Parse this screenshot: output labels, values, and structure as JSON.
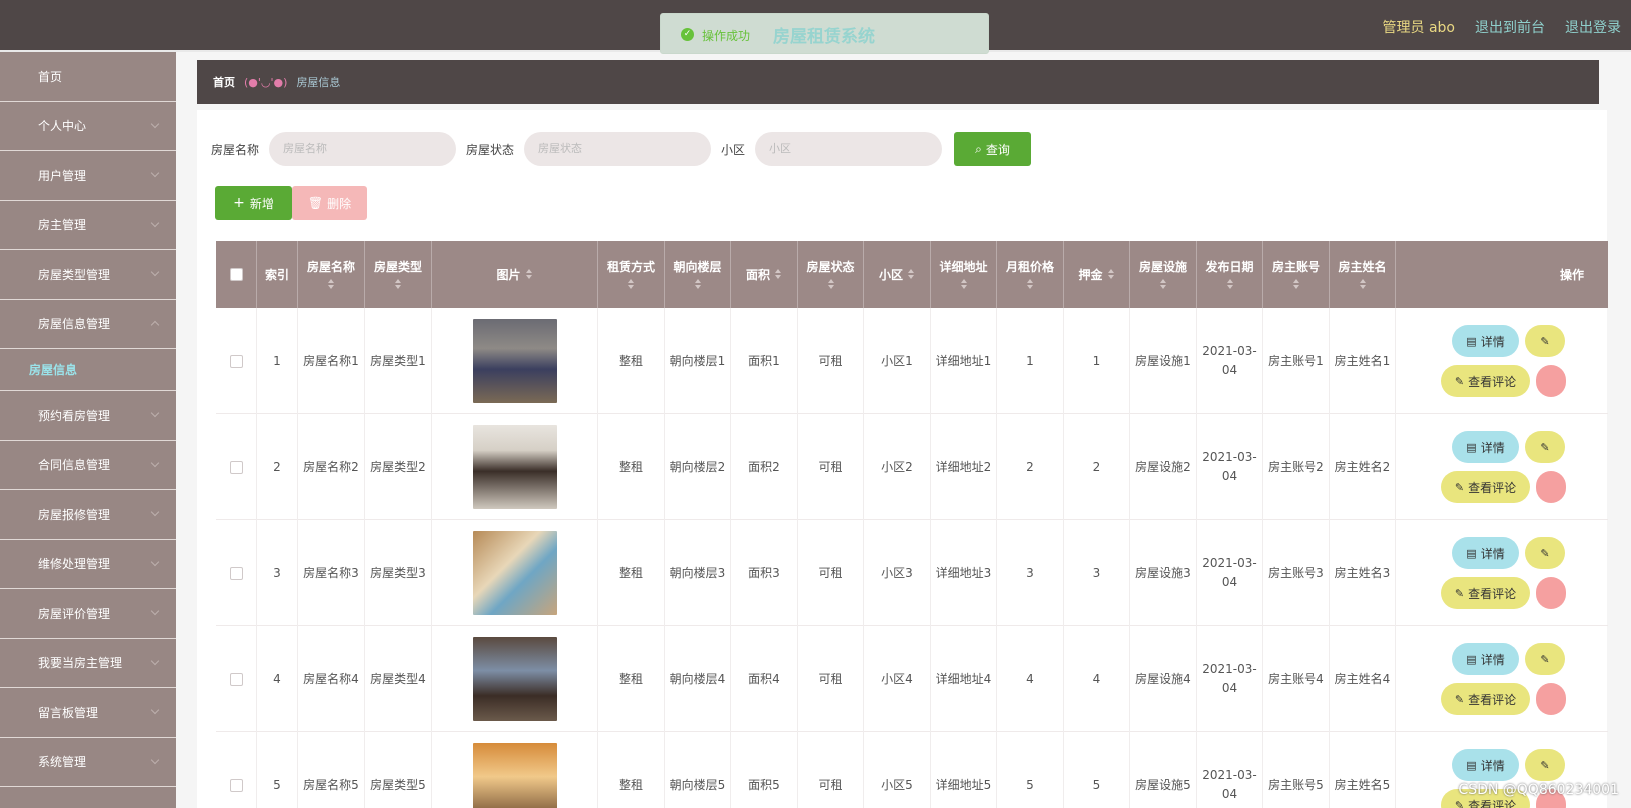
{
  "header": {
    "title": "房屋租赁系统",
    "admin_label": "管理员 abo",
    "to_front": "退出到前台",
    "logout": "退出登录"
  },
  "toast": {
    "message": "操作成功",
    "title": "房屋租赁系统"
  },
  "sidebar": {
    "items": [
      {
        "label": "首页"
      },
      {
        "label": "个人中心"
      },
      {
        "label": "用户管理"
      },
      {
        "label": "房主管理"
      },
      {
        "label": "房屋类型管理"
      },
      {
        "label": "房屋信息管理"
      },
      {
        "label": "预约看房管理"
      },
      {
        "label": "合同信息管理"
      },
      {
        "label": "房屋报修管理"
      },
      {
        "label": "维修处理管理"
      },
      {
        "label": "房屋评价管理"
      },
      {
        "label": "我要当房主管理"
      },
      {
        "label": "留言板管理"
      },
      {
        "label": "系统管理"
      }
    ],
    "active_sub": "房屋信息"
  },
  "breadcrumb": {
    "home": "首页",
    "face": "(●'◡'●)",
    "current": "房屋信息"
  },
  "search": {
    "name_label": "房屋名称",
    "name_placeholder": "房屋名称",
    "status_label": "房屋状态",
    "status_placeholder": "房屋状态",
    "area_label": "小区",
    "area_placeholder": "小区",
    "query_button": "查询"
  },
  "toolbar": {
    "add_label": "新增",
    "delete_label": "删除"
  },
  "table": {
    "columns": [
      "索引",
      "房屋名称",
      "房屋类型",
      "图片",
      "租赁方式",
      "朝向楼层",
      "面积",
      "房屋状态",
      "小区",
      "详细地址",
      "月租价格",
      "押金",
      "房屋设施",
      "发布日期",
      "房主账号",
      "房主姓名",
      "操作"
    ],
    "rows": [
      {
        "index": "1",
        "name": "房屋名称1",
        "type": "房屋类型1",
        "lease": "整租",
        "floor": "朝向楼层1",
        "area": "面积1",
        "status": "可租",
        "community": "小区1",
        "address": "详细地址1",
        "price": "1",
        "deposit": "1",
        "facility": "房屋设施1",
        "date": "2021-03-04",
        "owner_account": "房主账号1",
        "owner_name": "房主姓名1"
      },
      {
        "index": "2",
        "name": "房屋名称2",
        "type": "房屋类型2",
        "lease": "整租",
        "floor": "朝向楼层2",
        "area": "面积2",
        "status": "可租",
        "community": "小区2",
        "address": "详细地址2",
        "price": "2",
        "deposit": "2",
        "facility": "房屋设施2",
        "date": "2021-03-04",
        "owner_account": "房主账号2",
        "owner_name": "房主姓名2"
      },
      {
        "index": "3",
        "name": "房屋名称3",
        "type": "房屋类型3",
        "lease": "整租",
        "floor": "朝向楼层3",
        "area": "面积3",
        "status": "可租",
        "community": "小区3",
        "address": "详细地址3",
        "price": "3",
        "deposit": "3",
        "facility": "房屋设施3",
        "date": "2021-03-04",
        "owner_account": "房主账号3",
        "owner_name": "房主姓名3"
      },
      {
        "index": "4",
        "name": "房屋名称4",
        "type": "房屋类型4",
        "lease": "整租",
        "floor": "朝向楼层4",
        "area": "面积4",
        "status": "可租",
        "community": "小区4",
        "address": "详细地址4",
        "price": "4",
        "deposit": "4",
        "facility": "房屋设施4",
        "date": "2021-03-04",
        "owner_account": "房主账号4",
        "owner_name": "房主姓名4"
      },
      {
        "index": "5",
        "name": "房屋名称5",
        "type": "房屋类型5",
        "lease": "整租",
        "floor": "朝向楼层5",
        "area": "面积5",
        "status": "可租",
        "community": "小区5",
        "address": "详细地址5",
        "price": "5",
        "deposit": "5",
        "facility": "房屋设施5",
        "date": "2021-03-04",
        "owner_account": "房主账号5",
        "owner_name": "房主姓名5"
      }
    ],
    "actions": {
      "detail": "详情",
      "review": "查看评论"
    }
  },
  "watermark": "CSDN @QQ860234001",
  "colors": {
    "topbar": "#4f4747",
    "sidebar": "#988784",
    "header_row": "#9c8987",
    "primary_green": "#5aaa35",
    "detail_btn": "#a9e1ea",
    "review_btn": "#e9e57e"
  }
}
